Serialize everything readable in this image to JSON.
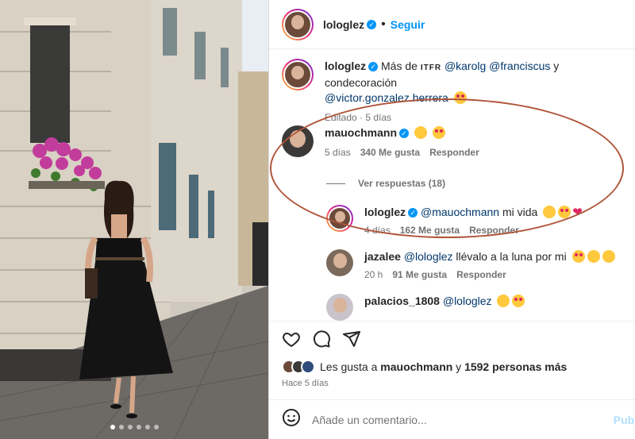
{
  "header": {
    "username": "lologlez",
    "follow_label": "Seguir",
    "separator": "•"
  },
  "caption": {
    "username": "lologlez",
    "text_prefix": "Más de ",
    "brand": "ITFR",
    "mention1": "@karolg",
    "mention2": "@franciscus",
    "text_mid": " y condecoración",
    "mention3": "@victor.gonzalez.herrera",
    "meta": "Editado · 5 días"
  },
  "comments": [
    {
      "username": "mauochmann",
      "time": "5 días",
      "likes": "340 Me gusta",
      "reply": "Responder"
    },
    {
      "username": "lologlez",
      "mention": "@mauochmann",
      "text": " mi vida",
      "time": "4 días",
      "likes": "162 Me gusta",
      "reply": "Responder"
    },
    {
      "username": "jazalee",
      "mention": "@lologlez",
      "text": " llévalo a la luna por mi",
      "time": "20 h",
      "likes": "91 Me gusta",
      "reply": "Responder"
    },
    {
      "username": "palacios_1808",
      "mention": "@lologlez"
    }
  ],
  "view_replies": "Ver respuestas (18)",
  "likes": {
    "prefix": "Les gusta a ",
    "user": "mauochmann",
    "mid": " y ",
    "count": "1592 personas más"
  },
  "post_time": "Hace 5 días",
  "add_comment": {
    "placeholder": "Añade un comentario...",
    "post": "Publicar"
  },
  "colors": {
    "accent": "#0095f6",
    "annotation": "#b0553a"
  },
  "carousel": {
    "slides": 6,
    "active": 0
  }
}
